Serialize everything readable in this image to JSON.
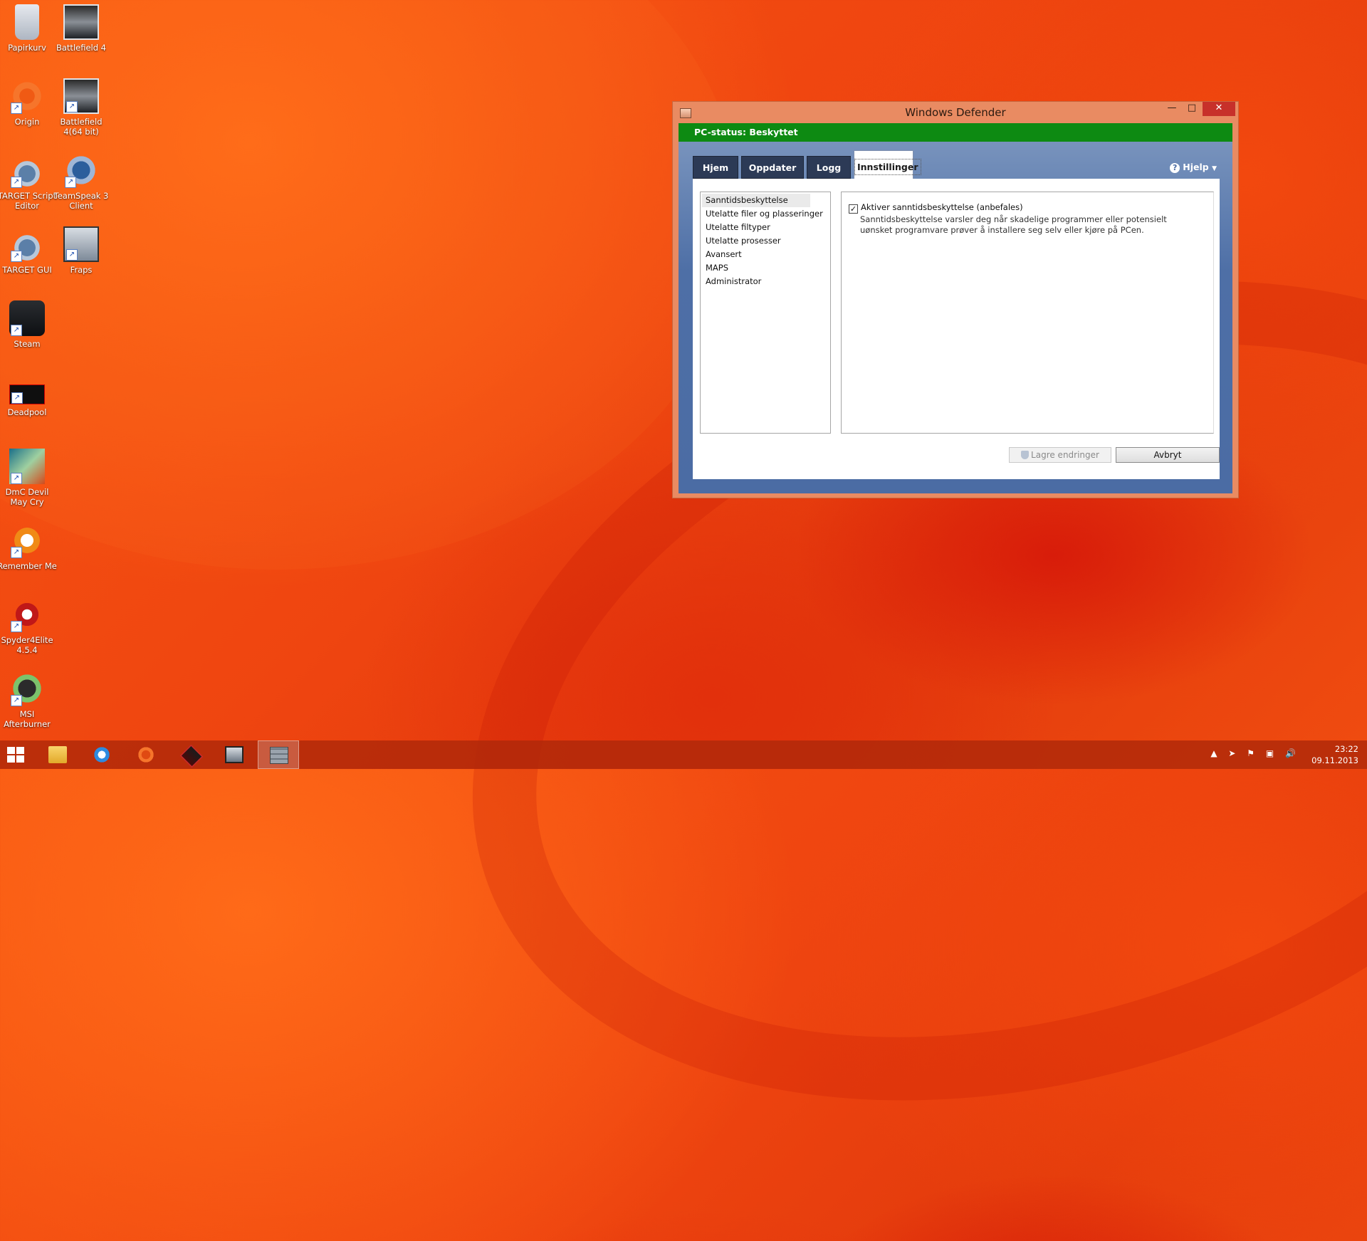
{
  "desktop_icons": [
    {
      "label": "Papirkurv",
      "icon": "recycle-bin-icon"
    },
    {
      "label": "Battlefield 4",
      "icon": "battlefield4-icon"
    },
    {
      "label": "Origin",
      "icon": "origin-icon"
    },
    {
      "label": "Battlefield 4(64 bit)",
      "icon": "battlefield4-64-icon"
    },
    {
      "label": "TARGET Script Editor",
      "icon": "target-script-editor-icon"
    },
    {
      "label": "TeamSpeak 3 Client",
      "icon": "teamspeak-icon"
    },
    {
      "label": "TARGET GUI",
      "icon": "target-gui-icon"
    },
    {
      "label": "Fraps",
      "icon": "fraps-icon"
    },
    {
      "label": "Steam",
      "icon": "steam-icon"
    },
    {
      "label": "Deadpool",
      "icon": "deadpool-icon"
    },
    {
      "label": "DmC Devil May Cry",
      "icon": "dmc-icon"
    },
    {
      "label": "Remember Me",
      "icon": "remember-me-icon"
    },
    {
      "label": "Spyder4Elite 4.5.4",
      "icon": "spyder-icon"
    },
    {
      "label": "MSI Afterburner",
      "icon": "msi-afterburner-icon"
    }
  ],
  "window": {
    "title": "Windows Defender",
    "status": "PC-status: Beskyttet",
    "tabs": [
      "Hjem",
      "Oppdater",
      "Logg",
      "Innstillinger"
    ],
    "active_tab": "Innstillinger",
    "help_label": "Hjelp",
    "nav_items": [
      "Sanntidsbeskyttelse",
      "Utelatte filer og plasseringer",
      "Utelatte filtyper",
      "Utelatte prosesser",
      "Avansert",
      "MAPS",
      "Administrator"
    ],
    "checkbox_label": "Aktiver sanntidsbeskyttelse (anbefales)",
    "checkbox_checked": true,
    "description": "Sanntidsbeskyttelse varsler deg når skadelige programmer eller potensielt uønsket programvare prøver å installere seg selv eller kjøre på PCen.",
    "save_button": "Lagre endringer",
    "cancel_button": "Avbryt"
  },
  "colors": {
    "status_green": "#0d8a12",
    "window_frame": "#e98b62",
    "client_blue": "#4e6fa6",
    "close_red": "#c7302a"
  },
  "taskbar": {
    "items": [
      "start",
      "file-explorer",
      "internet-explorer",
      "origin",
      "target",
      "fraps",
      "windows-defender"
    ],
    "active_item": "windows-defender",
    "time": "23:22",
    "date": "09.11.2013"
  }
}
